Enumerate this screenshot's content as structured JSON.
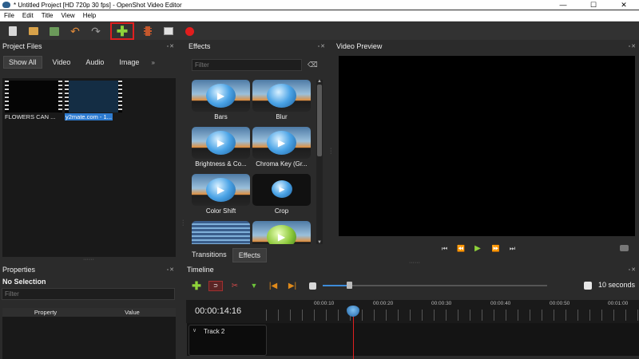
{
  "window": {
    "title": "* Untitled Project [HD 720p 30 fps] - OpenShot Video Editor",
    "minimize": "—",
    "maximize": "☐",
    "close": "✕"
  },
  "menu": [
    "File",
    "Edit",
    "Title",
    "View",
    "Help"
  ],
  "toolbar": {
    "icons": [
      "new-project-icon",
      "open-project-icon",
      "save-project-icon",
      "undo-icon",
      "redo-icon",
      "add-file-icon",
      "choose-profile-icon",
      "export-video-icon",
      "record-icon"
    ],
    "add_symbol": "✚",
    "undo_symbol": "↶",
    "redo_symbol": "↷",
    "highlight_color": "#e02020"
  },
  "project_files": {
    "title": "Project Files",
    "tabs": [
      "Show All",
      "Video",
      "Audio",
      "Image"
    ],
    "more": "»",
    "files": [
      "FLOWERS CAN ...",
      "y2mate.com - 1..."
    ]
  },
  "effects": {
    "title": "Effects",
    "filter_placeholder": "Filter",
    "clear_symbol": "⌫",
    "items": [
      "Bars",
      "Blur",
      "Brightness & Co...",
      "Chroma Key (Gr...",
      "Color Shift",
      "Crop"
    ],
    "tabs": [
      "Transitions",
      "Effects"
    ]
  },
  "video_preview": {
    "title": "Video Preview",
    "controls": {
      "jump_start": "⏮",
      "rewind": "⏪",
      "play": "▶",
      "fast_forward": "⏩",
      "jump_end": "⏭"
    }
  },
  "properties": {
    "title": "Properties",
    "selection": "No Selection",
    "filter_placeholder": "Filter",
    "columns": [
      "Property",
      "Value"
    ]
  },
  "timeline": {
    "title": "Timeline",
    "current_time": "00:00:14:16",
    "zoom_label": "10 seconds",
    "ruler": [
      "00:00:10",
      "00:00:20",
      "00:00:30",
      "00:00:40",
      "00:00:50",
      "00:01:00"
    ],
    "tracks": [
      "Track 2"
    ]
  },
  "panel_controls": "▫✕",
  "colors": {
    "background": "#2b2b2b",
    "accent": "#2d7bd0",
    "playhead": "#e02020",
    "play_green": "#8ed23a"
  }
}
